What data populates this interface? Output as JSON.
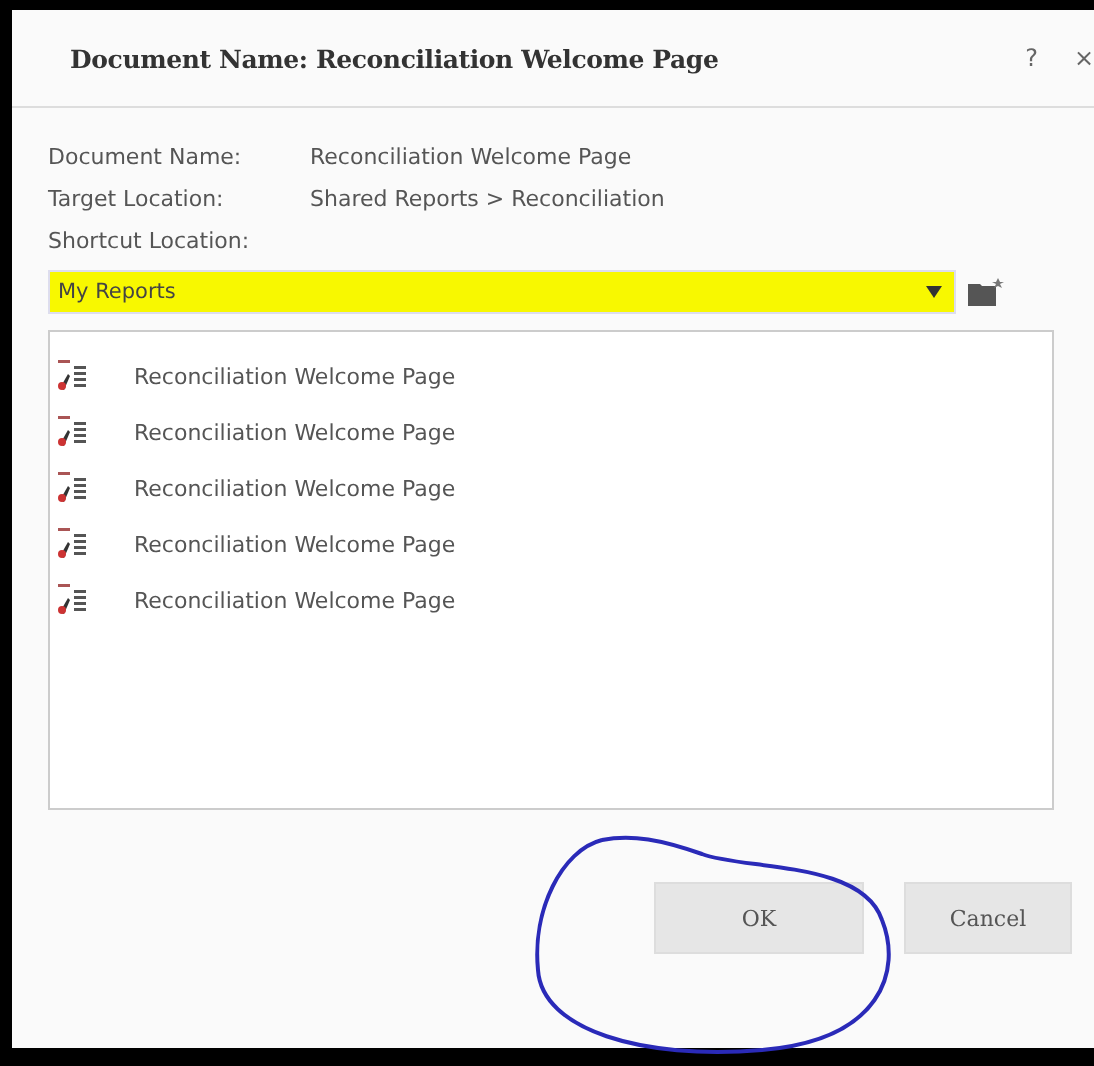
{
  "dialog": {
    "title": "Document Name: Reconciliation Welcome Page",
    "help": "?",
    "close": "×"
  },
  "fields": [
    {
      "label": "Document Name:",
      "value": "Reconciliation Welcome Page"
    },
    {
      "label": "Target Location:",
      "value": "Shared Reports > Reconciliation"
    },
    {
      "label": "Shortcut Location:"
    }
  ],
  "location_dropdown": {
    "value": "My Reports"
  },
  "documents": [
    {
      "name": "Reconciliation Welcome Page"
    },
    {
      "name": "Reconciliation Welcome Page"
    },
    {
      "name": "Reconciliation Welcome Page"
    },
    {
      "name": "Reconciliation Welcome Page"
    },
    {
      "name": "Reconciliation Welcome Page"
    }
  ],
  "buttons": [
    {
      "label": "OK"
    },
    {
      "label": "Cancel"
    }
  ]
}
